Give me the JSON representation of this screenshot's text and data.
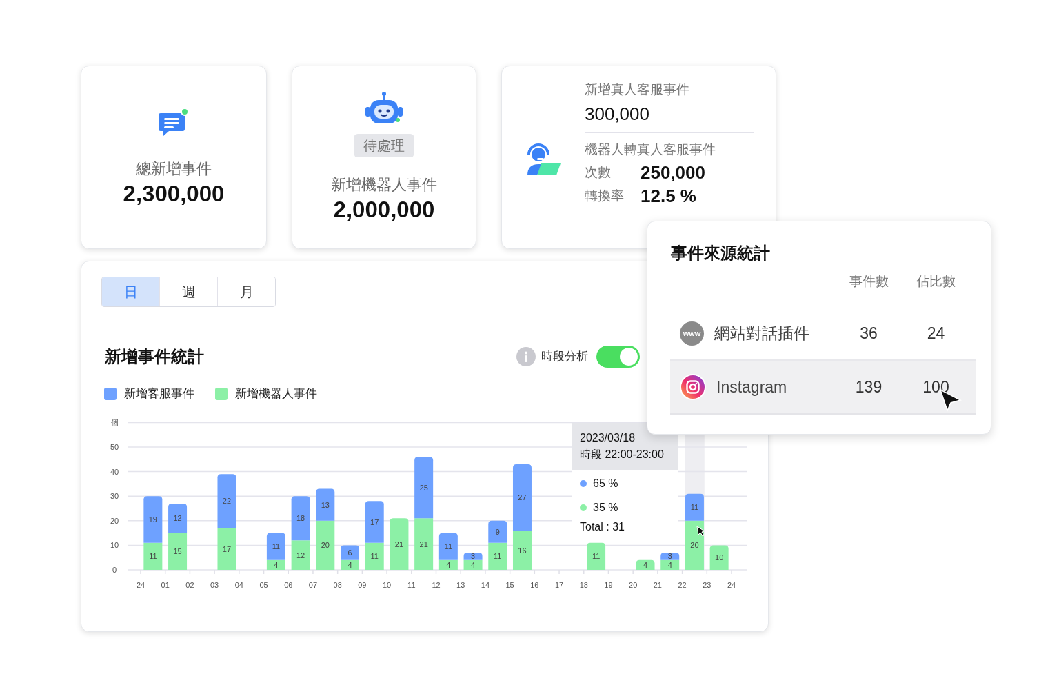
{
  "stat_cards": [
    {
      "kind": "chat",
      "label": "總新增事件",
      "value": "2,300,000"
    },
    {
      "kind": "robot",
      "badge": "待處理",
      "label": "新增機器人事件",
      "value": "2,000,000"
    }
  ],
  "agent_card": {
    "title": "新增真人客服事件",
    "value": "300,000",
    "subtitle": "機器人轉真人客服事件",
    "rows": [
      {
        "label": "次數",
        "value": "250,000"
      },
      {
        "label": "轉換率",
        "value": "12.5 %"
      }
    ]
  },
  "chart_panel": {
    "tabs": [
      {
        "label": "日",
        "selected": true
      },
      {
        "label": "週",
        "selected": false
      },
      {
        "label": "月",
        "selected": false
      }
    ],
    "title": "新增事件統計",
    "xaxis_start_label": "24",
    "toggle": {
      "label": "時段分析",
      "on": true
    },
    "chart_data": {
      "type": "bar",
      "stacked": true,
      "grid": true,
      "ylabel": "個",
      "data_labels": true,
      "xlim": [
        0,
        24
      ],
      "ylim": [
        0,
        60
      ],
      "x": [
        0.5,
        1.5,
        2.5,
        3.5,
        4.5,
        5.5,
        6.5,
        7.5,
        8.5,
        9.5,
        10.5,
        11.5,
        12.5,
        13.5,
        14.5,
        15.5,
        16.5,
        17.5,
        18.5,
        19.5,
        20.5,
        21.5,
        22.5,
        23.5
      ],
      "series": [
        {
          "name": "新增機器人事件",
          "color": "#8cf0a6",
          "values": [
            11,
            15,
            null,
            17,
            null,
            4,
            12,
            20,
            4,
            11,
            21,
            21,
            4,
            4,
            11,
            16,
            null,
            null,
            11,
            null,
            4,
            4,
            20,
            10
          ]
        },
        {
          "name": "新增客服事件",
          "color": "#6ea1ff",
          "values": [
            19,
            12,
            null,
            22,
            null,
            11,
            18,
            13,
            6,
            17,
            null,
            25,
            11,
            3,
            9,
            27,
            null,
            null,
            null,
            null,
            null,
            3,
            11,
            null
          ]
        }
      ],
      "yticks": [
        0,
        10,
        20,
        30,
        40,
        50
      ],
      "xticks": [
        {
          "value": 1,
          "label": "01"
        },
        {
          "value": 2,
          "label": "02"
        },
        {
          "value": 3,
          "label": "03"
        },
        {
          "value": 4,
          "label": "04"
        },
        {
          "value": 5,
          "label": "05"
        },
        {
          "value": 6,
          "label": "06"
        },
        {
          "value": 7,
          "label": "07"
        },
        {
          "value": 8,
          "label": "08"
        },
        {
          "value": 9,
          "label": "09"
        },
        {
          "value": 10,
          "label": "10"
        },
        {
          "value": 11,
          "label": "11"
        },
        {
          "value": 12,
          "label": "12"
        },
        {
          "value": 13,
          "label": "13"
        },
        {
          "value": 14,
          "label": "14"
        },
        {
          "value": 15,
          "label": "15"
        },
        {
          "value": 16,
          "label": "16"
        },
        {
          "value": 17,
          "label": "17"
        },
        {
          "value": 18,
          "label": "18"
        },
        {
          "value": 19,
          "label": "19"
        },
        {
          "value": 20,
          "label": "20"
        },
        {
          "value": 21,
          "label": "21"
        },
        {
          "value": 22,
          "label": "22"
        },
        {
          "value": 23,
          "label": "23"
        },
        {
          "value": 24,
          "label": "24"
        }
      ],
      "bands": [
        {
          "axis": "x",
          "from": 22.1,
          "to": 22.9,
          "color": "#eeeef2"
        }
      ]
    },
    "tooltip": {
      "date": "2023/03/18",
      "period": "時段 22:00-23:00",
      "items": [
        {
          "label": "65 %",
          "color": "#6ea1ff"
        },
        {
          "label": "35 %",
          "color": "#8cf0a6"
        }
      ],
      "total": "Total : 31"
    }
  },
  "source_popup": {
    "title": "事件來源統計",
    "columns": [
      "事件數",
      "佔比數"
    ],
    "rows": [
      {
        "kind": "web",
        "icon_text": "www",
        "name": "網站對話插件",
        "count": "36",
        "share": "24",
        "selected": false
      },
      {
        "kind": "instagram",
        "name": "Instagram",
        "count": "139",
        "share": "100",
        "selected": true
      }
    ]
  }
}
